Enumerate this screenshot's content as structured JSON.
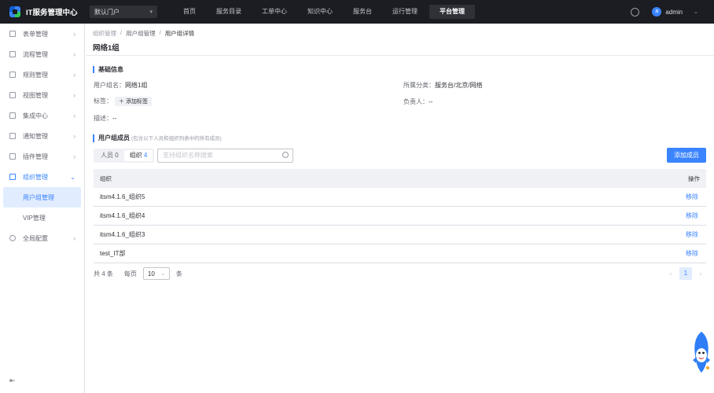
{
  "header": {
    "app_title": "IT服务管理中心",
    "portal_select": "默认门户",
    "nav": [
      "首页",
      "服务目录",
      "工单中心",
      "知识中心",
      "服务台",
      "运行管理",
      "平台管理"
    ],
    "active_nav": "平台管理",
    "avatar_letter": "a",
    "username": "admin"
  },
  "sidebar": {
    "items": [
      {
        "label": "表单管理",
        "icon": "form-icon"
      },
      {
        "label": "流程管理",
        "icon": "flow-icon"
      },
      {
        "label": "规则管理",
        "icon": "rule-icon"
      },
      {
        "label": "视图管理",
        "icon": "view-icon"
      },
      {
        "label": "集成中心",
        "icon": "integration-icon"
      },
      {
        "label": "通知管理",
        "icon": "bell-icon"
      },
      {
        "label": "插件管理",
        "icon": "plugin-icon"
      },
      {
        "label": "组织管理",
        "icon": "org-icon"
      }
    ],
    "sub_items": [
      "用户组管理",
      "VIP管理"
    ],
    "last_item": {
      "label": "全局配置",
      "icon": "settings-icon"
    }
  },
  "breadcrumb": [
    "组织管理",
    "用户组管理",
    "用户组详情"
  ],
  "page_title": "网络1组",
  "basic_info": {
    "title": "基础信息",
    "group_name_label": "用户组名：",
    "group_name_value": "网络1组",
    "category_label": "所属分类：",
    "category_value": "服务台/北京/网络",
    "tag_label": "标签：",
    "add_tag": "添加标签",
    "owner_label": "负责人：",
    "owner_value": "--",
    "desc_label": "描述：",
    "desc_value": "--"
  },
  "members": {
    "title": "用户组成员",
    "hint": "(包含以下人员和组织列表中的所有成员)",
    "tab_people": "人员",
    "tab_people_count": "0",
    "tab_org": "组织",
    "tab_org_count": "4",
    "search_placeholder": "支持组织名称搜索",
    "add_button": "添加成员",
    "col_org": "组织",
    "col_op": "操作",
    "rows": [
      {
        "org": "itsm4.1.6_组织5",
        "op": "移除"
      },
      {
        "org": "itsm4.1.6_组织4",
        "op": "移除"
      },
      {
        "org": "itsm4.1.6_组织3",
        "op": "移除"
      },
      {
        "org": "test_IT部",
        "op": "移除"
      }
    ]
  },
  "pagination": {
    "total": "共 4 条",
    "per_page_label": "每页",
    "per_page_value": "10",
    "unit": "条",
    "current_page": "1"
  }
}
